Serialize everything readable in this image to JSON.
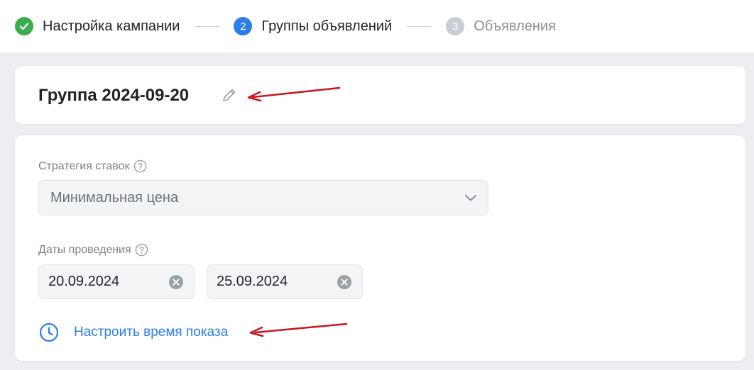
{
  "stepper": {
    "steps": [
      {
        "number": "",
        "label": "Настройка кампании",
        "status": "done"
      },
      {
        "number": "2",
        "label": "Группы объявлений",
        "status": "active"
      },
      {
        "number": "3",
        "label": "Объявления",
        "status": "todo"
      }
    ]
  },
  "group": {
    "title": "Группа 2024-09-20"
  },
  "form": {
    "strategy": {
      "label": "Стратегия ставок",
      "value": "Минимальная цена"
    },
    "dates": {
      "label": "Даты проведения",
      "start": "20.09.2024",
      "end": "25.09.2024"
    },
    "schedule_link": "Настроить время показа"
  },
  "colors": {
    "accent": "#2b7de9",
    "success": "#3dab4e",
    "annotation_arrow": "#c8161d"
  },
  "icons": [
    "check-icon",
    "pencil-icon",
    "question-icon",
    "chevron-down-icon",
    "clear-icon",
    "clock-icon"
  ]
}
